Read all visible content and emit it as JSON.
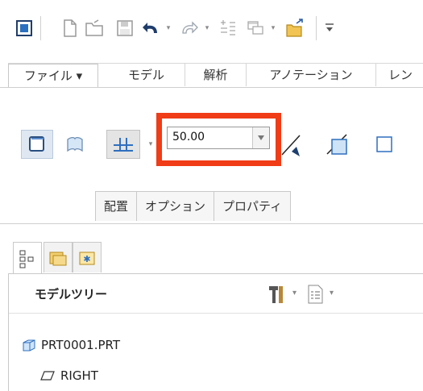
{
  "ribbon_tabs": [
    {
      "label": "ファイル ▾"
    },
    {
      "label": "モデル"
    },
    {
      "label": "解析"
    },
    {
      "label": "アノテーション"
    },
    {
      "label": "レン"
    }
  ],
  "extrude": {
    "depth_value": "50.00"
  },
  "dashboard_tabs": [
    {
      "label": "配置"
    },
    {
      "label": "オプション"
    },
    {
      "label": "プロパティ"
    }
  ],
  "navigator": {
    "title": "モデルツリー",
    "items": [
      {
        "label": "PRT0001.PRT"
      },
      {
        "label": "RIGHT"
      }
    ]
  },
  "colors": {
    "highlight": "#f03c17",
    "accent_blue": "#3b7fd1",
    "toolbar_bg": "#ffffff"
  }
}
